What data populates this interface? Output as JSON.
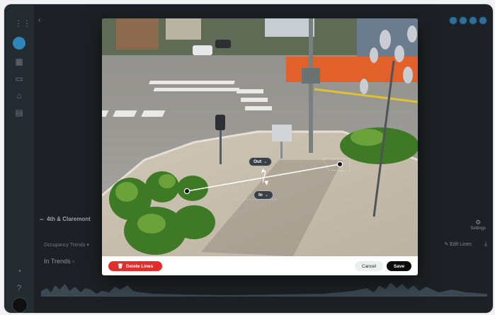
{
  "background": {
    "camera_badge": "",
    "camera_name": "4th & Claremont",
    "camera_sub": "",
    "occupancy_label": "Occupancy Trends",
    "trends_label": "In Trends",
    "settings_label": "Settings",
    "edit_lines_label": "Edit Lines"
  },
  "modal": {
    "direction_out": "Out",
    "direction_in": "In",
    "delete_label": "Delete Lines",
    "cancel_label": "Cancel",
    "save_label": "Save"
  },
  "colors": {
    "delete": "#e12d2d",
    "save": "#0b0b0d",
    "accent": "#2e86b8"
  },
  "icons": [
    "grid-icon",
    "home-icon",
    "camera-icon",
    "people-icon",
    "folder-icon",
    "bell-icon",
    "help-icon",
    "trash-icon",
    "download-icon",
    "gear-icon",
    "pencil-icon"
  ]
}
